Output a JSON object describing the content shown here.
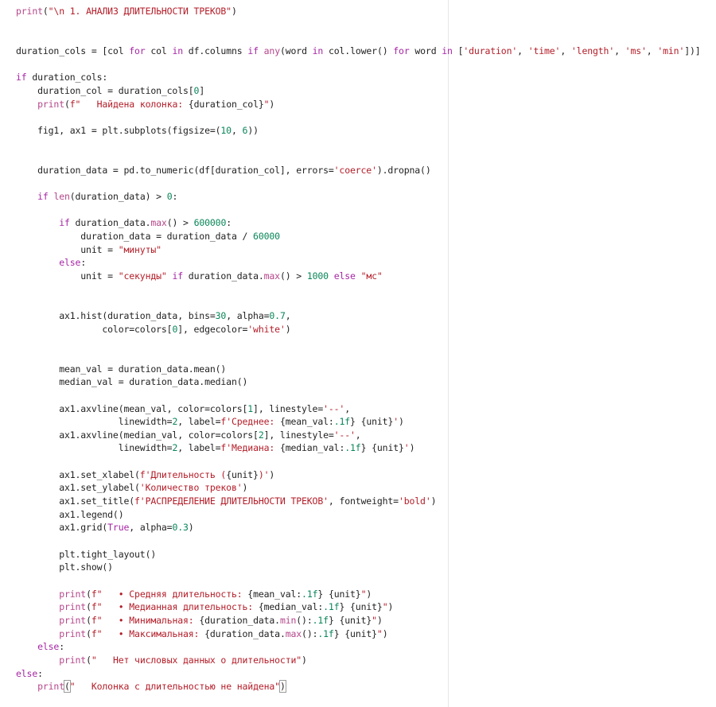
{
  "editor": {
    "lines": [
      [
        [
          "bi",
          "print"
        ],
        [
          "tx",
          "("
        ],
        [
          "str",
          "\"\\n 1. АНАЛИЗ ДЛИТЕЛЬНОСТИ ТРЕКОВ\""
        ],
        [
          "tx",
          ")"
        ]
      ],
      [],
      [],
      [
        [
          "tx",
          "duration_cols = [col "
        ],
        [
          "kw",
          "for"
        ],
        [
          "tx",
          " col "
        ],
        [
          "kw",
          "in"
        ],
        [
          "tx",
          " df.columns "
        ],
        [
          "kw",
          "if"
        ],
        [
          "tx",
          " "
        ],
        [
          "bi",
          "any"
        ],
        [
          "tx",
          "(word "
        ],
        [
          "kw",
          "in"
        ],
        [
          "tx",
          " col.lower() "
        ],
        [
          "kw",
          "for"
        ],
        [
          "tx",
          " word "
        ],
        [
          "kw",
          "in"
        ],
        [
          "tx",
          " ["
        ],
        [
          "str",
          "'duration'"
        ],
        [
          "tx",
          ", "
        ],
        [
          "str",
          "'time'"
        ],
        [
          "tx",
          ", "
        ],
        [
          "str",
          "'length'"
        ],
        [
          "tx",
          ", "
        ],
        [
          "str",
          "'ms'"
        ],
        [
          "tx",
          ", "
        ],
        [
          "str",
          "'min'"
        ],
        [
          "tx",
          "])]"
        ]
      ],
      [],
      [
        [
          "kw",
          "if"
        ],
        [
          "tx",
          " duration_cols:"
        ]
      ],
      [
        [
          "tx",
          "    duration_col = duration_cols["
        ],
        [
          "num",
          "0"
        ],
        [
          "tx",
          "]"
        ]
      ],
      [
        [
          "tx",
          "    "
        ],
        [
          "bi",
          "print"
        ],
        [
          "tx",
          "("
        ],
        [
          "str",
          "f\"   Найдена колонка: "
        ],
        [
          "tx",
          "{duration_col}"
        ],
        [
          "str",
          "\""
        ],
        [
          "tx",
          ")"
        ]
      ],
      [],
      [
        [
          "tx",
          "    fig1, ax1 = plt.subplots(figsize=("
        ],
        [
          "num",
          "10"
        ],
        [
          "tx",
          ", "
        ],
        [
          "num",
          "6"
        ],
        [
          "tx",
          "))"
        ]
      ],
      [],
      [],
      [
        [
          "tx",
          "    duration_data = pd.to_numeric(df[duration_col], errors="
        ],
        [
          "str",
          "'coerce'"
        ],
        [
          "tx",
          ").dropna()"
        ]
      ],
      [],
      [
        [
          "tx",
          "    "
        ],
        [
          "kw",
          "if"
        ],
        [
          "tx",
          " "
        ],
        [
          "bi",
          "len"
        ],
        [
          "tx",
          "(duration_data) > "
        ],
        [
          "num",
          "0"
        ],
        [
          "tx",
          ":"
        ]
      ],
      [],
      [
        [
          "tx",
          "        "
        ],
        [
          "kw",
          "if"
        ],
        [
          "tx",
          " duration_data."
        ],
        [
          "bi",
          "max"
        ],
        [
          "tx",
          "() > "
        ],
        [
          "num",
          "600000"
        ],
        [
          "tx",
          ":"
        ]
      ],
      [
        [
          "tx",
          "            duration_data = duration_data / "
        ],
        [
          "num",
          "60000"
        ]
      ],
      [
        [
          "tx",
          "            unit = "
        ],
        [
          "str",
          "\"минуты\""
        ]
      ],
      [
        [
          "tx",
          "        "
        ],
        [
          "kw",
          "else"
        ],
        [
          "tx",
          ":"
        ]
      ],
      [
        [
          "tx",
          "            unit = "
        ],
        [
          "str",
          "\"секунды\""
        ],
        [
          "tx",
          " "
        ],
        [
          "kw",
          "if"
        ],
        [
          "tx",
          " duration_data."
        ],
        [
          "bi",
          "max"
        ],
        [
          "tx",
          "() > "
        ],
        [
          "num",
          "1000"
        ],
        [
          "tx",
          " "
        ],
        [
          "kw",
          "else"
        ],
        [
          "tx",
          " "
        ],
        [
          "str",
          "\"мс\""
        ]
      ],
      [],
      [],
      [
        [
          "tx",
          "        ax1.hist(duration_data, bins="
        ],
        [
          "num",
          "30"
        ],
        [
          "tx",
          ", alpha="
        ],
        [
          "num",
          "0.7"
        ],
        [
          "tx",
          ","
        ]
      ],
      [
        [
          "tx",
          "                color=colors["
        ],
        [
          "num",
          "0"
        ],
        [
          "tx",
          "], edgecolor="
        ],
        [
          "str",
          "'white'"
        ],
        [
          "tx",
          ")"
        ]
      ],
      [],
      [],
      [
        [
          "tx",
          "        mean_val = duration_data.mean()"
        ]
      ],
      [
        [
          "tx",
          "        median_val = duration_data.median()"
        ]
      ],
      [],
      [
        [
          "tx",
          "        ax1.axvline(mean_val, color=colors["
        ],
        [
          "num",
          "1"
        ],
        [
          "tx",
          "], linestyle="
        ],
        [
          "str",
          "'--'"
        ],
        [
          "tx",
          ","
        ]
      ],
      [
        [
          "tx",
          "                   linewidth="
        ],
        [
          "num",
          "2"
        ],
        [
          "tx",
          ", label="
        ],
        [
          "str",
          "f'Среднее: "
        ],
        [
          "tx",
          "{mean_val:"
        ],
        [
          "num",
          ".1f"
        ],
        [
          "tx",
          "}"
        ],
        [
          "str",
          " "
        ],
        [
          "tx",
          "{unit}"
        ],
        [
          "str",
          "'"
        ],
        [
          "tx",
          ")"
        ]
      ],
      [
        [
          "tx",
          "        ax1.axvline(median_val, color=colors["
        ],
        [
          "num",
          "2"
        ],
        [
          "tx",
          "], linestyle="
        ],
        [
          "str",
          "'--'"
        ],
        [
          "tx",
          ","
        ]
      ],
      [
        [
          "tx",
          "                   linewidth="
        ],
        [
          "num",
          "2"
        ],
        [
          "tx",
          ", label="
        ],
        [
          "str",
          "f'Медиана: "
        ],
        [
          "tx",
          "{median_val:"
        ],
        [
          "num",
          ".1f"
        ],
        [
          "tx",
          "}"
        ],
        [
          "str",
          " "
        ],
        [
          "tx",
          "{unit}"
        ],
        [
          "str",
          "'"
        ],
        [
          "tx",
          ")"
        ]
      ],
      [],
      [
        [
          "tx",
          "        ax1.set_xlabel("
        ],
        [
          "str",
          "f'Длительность ("
        ],
        [
          "tx",
          "{unit}"
        ],
        [
          "str",
          ")'"
        ],
        [
          "tx",
          ")"
        ]
      ],
      [
        [
          "tx",
          "        ax1.set_ylabel("
        ],
        [
          "str",
          "'Количество треков'"
        ],
        [
          "tx",
          ")"
        ]
      ],
      [
        [
          "tx",
          "        ax1.set_title("
        ],
        [
          "str",
          "f'РАСПРЕДЕЛЕНИЕ ДЛИТЕЛЬНОСТИ ТРЕКОВ'"
        ],
        [
          "tx",
          ", fontweight="
        ],
        [
          "str",
          "'bold'"
        ],
        [
          "tx",
          ")"
        ]
      ],
      [
        [
          "tx",
          "        ax1.legend()"
        ]
      ],
      [
        [
          "tx",
          "        ax1.grid("
        ],
        [
          "kw",
          "True"
        ],
        [
          "tx",
          ", alpha="
        ],
        [
          "num",
          "0.3"
        ],
        [
          "tx",
          ")"
        ]
      ],
      [],
      [
        [
          "tx",
          "        plt.tight_layout()"
        ]
      ],
      [
        [
          "tx",
          "        plt.show()"
        ]
      ],
      [],
      [
        [
          "tx",
          "        "
        ],
        [
          "bi",
          "print"
        ],
        [
          "tx",
          "("
        ],
        [
          "str",
          "f\"   • Средняя длительность: "
        ],
        [
          "tx",
          "{mean_val:"
        ],
        [
          "num",
          ".1f"
        ],
        [
          "tx",
          "}"
        ],
        [
          "str",
          " "
        ],
        [
          "tx",
          "{unit}"
        ],
        [
          "str",
          "\""
        ],
        [
          "tx",
          ")"
        ]
      ],
      [
        [
          "tx",
          "        "
        ],
        [
          "bi",
          "print"
        ],
        [
          "tx",
          "("
        ],
        [
          "str",
          "f\"   • Медианная длительность: "
        ],
        [
          "tx",
          "{median_val:"
        ],
        [
          "num",
          ".1f"
        ],
        [
          "tx",
          "}"
        ],
        [
          "str",
          " "
        ],
        [
          "tx",
          "{unit}"
        ],
        [
          "str",
          "\""
        ],
        [
          "tx",
          ")"
        ]
      ],
      [
        [
          "tx",
          "        "
        ],
        [
          "bi",
          "print"
        ],
        [
          "tx",
          "("
        ],
        [
          "str",
          "f\"   • Минимальная: "
        ],
        [
          "tx",
          "{duration_data."
        ],
        [
          "bi",
          "min"
        ],
        [
          "tx",
          "():"
        ],
        [
          "num",
          ".1f"
        ],
        [
          "tx",
          "}"
        ],
        [
          "str",
          " "
        ],
        [
          "tx",
          "{unit}"
        ],
        [
          "str",
          "\""
        ],
        [
          "tx",
          ")"
        ]
      ],
      [
        [
          "tx",
          "        "
        ],
        [
          "bi",
          "print"
        ],
        [
          "tx",
          "("
        ],
        [
          "str",
          "f\"   • Максимальная: "
        ],
        [
          "tx",
          "{duration_data."
        ],
        [
          "bi",
          "max"
        ],
        [
          "tx",
          "():"
        ],
        [
          "num",
          ".1f"
        ],
        [
          "tx",
          "}"
        ],
        [
          "str",
          " "
        ],
        [
          "tx",
          "{unit}"
        ],
        [
          "str",
          "\""
        ],
        [
          "tx",
          ")"
        ]
      ],
      [
        [
          "tx",
          "    "
        ],
        [
          "kw",
          "else"
        ],
        [
          "tx",
          ":"
        ]
      ],
      [
        [
          "tx",
          "        "
        ],
        [
          "bi",
          "print"
        ],
        [
          "tx",
          "("
        ],
        [
          "str",
          "\"   Нет числовых данных о длительности\""
        ],
        [
          "tx",
          ")"
        ]
      ],
      [
        [
          "kw",
          "else"
        ],
        [
          "tx",
          ":"
        ]
      ],
      [
        [
          "tx",
          "    "
        ],
        [
          "bi",
          "print"
        ],
        [
          "tx",
          "("
        ],
        [
          "str",
          "\"   Колонка с длительностью не найдена\""
        ],
        [
          "tx",
          ")"
        ]
      ]
    ]
  }
}
